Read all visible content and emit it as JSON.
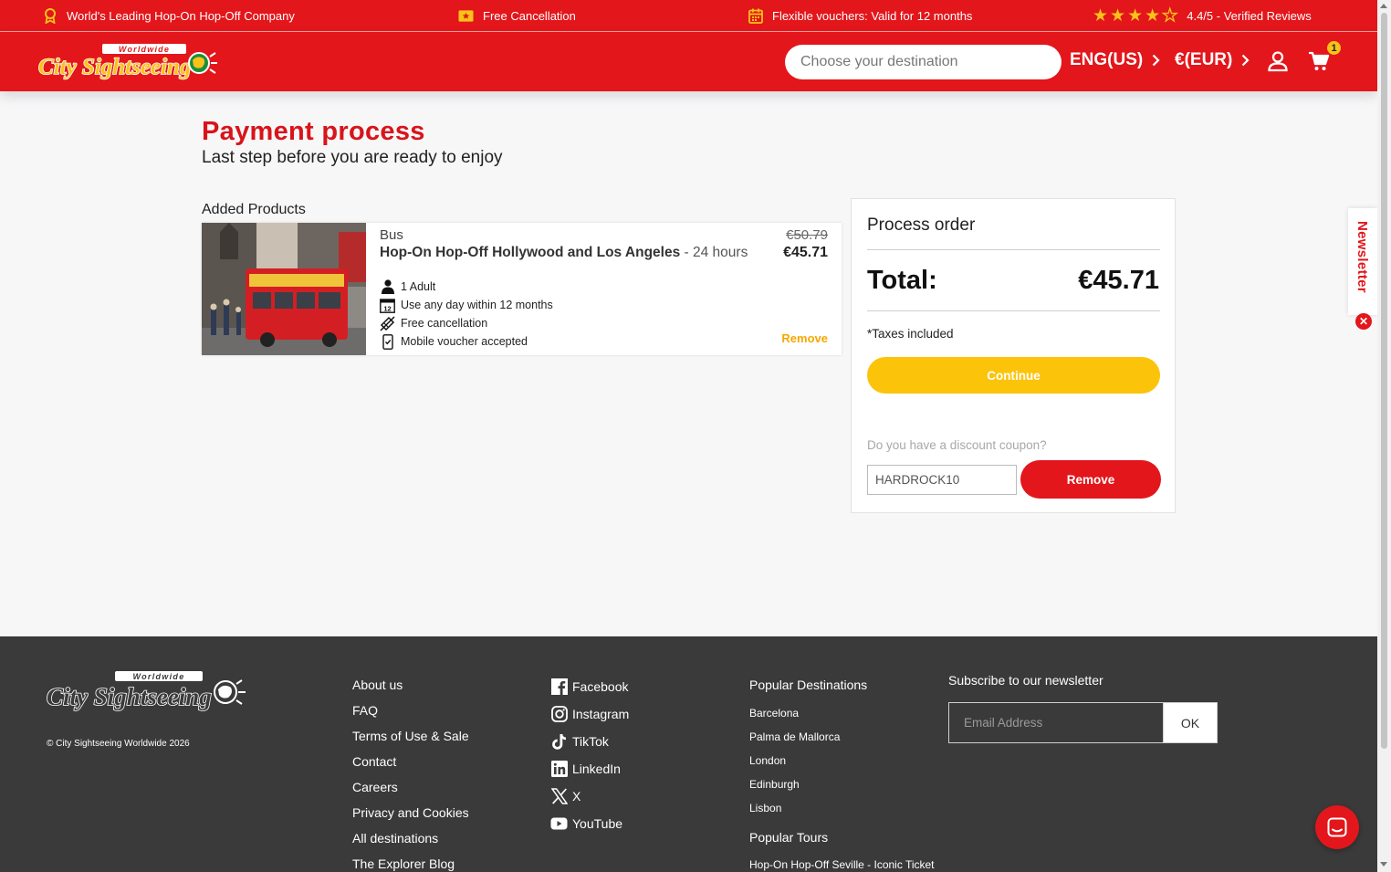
{
  "topbar": {
    "item1": "World's Leading Hop-On Hop-Off Company",
    "item2": "Free Cancellation",
    "item3": "Flexible vouchers: Valid for 12 months",
    "rating": "4.4/5 - Verified Reviews",
    "rating_value": 4.4,
    "star_color": "#f9c21a"
  },
  "header": {
    "logo_text": "City Sightseeing",
    "logo_sub": "Worldwide",
    "search_placeholder": "Choose your destination",
    "language": "ENG(US)",
    "currency": "€(EUR)",
    "cart_count": "1",
    "brand_color": "#e3161b"
  },
  "page": {
    "title": "Payment process",
    "subtitle": "Last step before you are ready to enjoy",
    "added_products": "Added Products"
  },
  "product": {
    "category": "Bus",
    "name": "Hop-On Hop-Off Hollywood and Los Angeles",
    "duration": " - 24 hours",
    "old_price": "€50.79",
    "price": "€45.71",
    "remove": "Remove",
    "features": [
      {
        "icon": "person-icon",
        "text": "1 Adult"
      },
      {
        "icon": "calendar-icon",
        "text": "Use any day within 12 months"
      },
      {
        "icon": "cancel-ticket-icon",
        "text": "Free cancellation"
      },
      {
        "icon": "phone-check-icon",
        "text": "Mobile voucher accepted"
      }
    ]
  },
  "order": {
    "title": "Process order",
    "total_label": "Total:",
    "total_value": "€45.71",
    "taxes": "*Taxes included",
    "continue": "Continue",
    "coupon_label": "Do you have a discount coupon?",
    "coupon_value": "HARDROCK10",
    "coupon_remove": "Remove",
    "accent_color": "#fcc30b"
  },
  "newsletter_tab": {
    "label": "Newsletter",
    "close": "✕"
  },
  "footer": {
    "logo_text": "City Sightseeing",
    "logo_sub": "Worldwide",
    "copyright": "© City Sightseeing Worldwide 2026",
    "links": [
      "About us",
      "FAQ",
      "Terms of Use & Sale",
      "Contact",
      "Careers",
      "Privacy and Cookies",
      "All destinations",
      "The Explorer Blog"
    ],
    "social": [
      {
        "icon": "facebook-icon",
        "label": "Facebook"
      },
      {
        "icon": "instagram-icon",
        "label": "Instagram"
      },
      {
        "icon": "tiktok-icon",
        "label": "TikTok"
      },
      {
        "icon": "linkedin-icon",
        "label": "LinkedIn"
      },
      {
        "icon": "x-icon",
        "label": "X"
      },
      {
        "icon": "youtube-icon",
        "label": "YouTube"
      }
    ],
    "popular_destinations_title": "Popular Destinations",
    "destinations": [
      "Barcelona",
      "Palma de Mallorca",
      "London",
      "Edinburgh",
      "Lisbon"
    ],
    "popular_tours_title": "Popular Tours",
    "tours": [
      "Hop-On Hop-Off Seville - Iconic Ticket"
    ],
    "newsletter_title": "Subscribe to our newsletter",
    "email_placeholder": "Email Address",
    "ok": "OK"
  }
}
